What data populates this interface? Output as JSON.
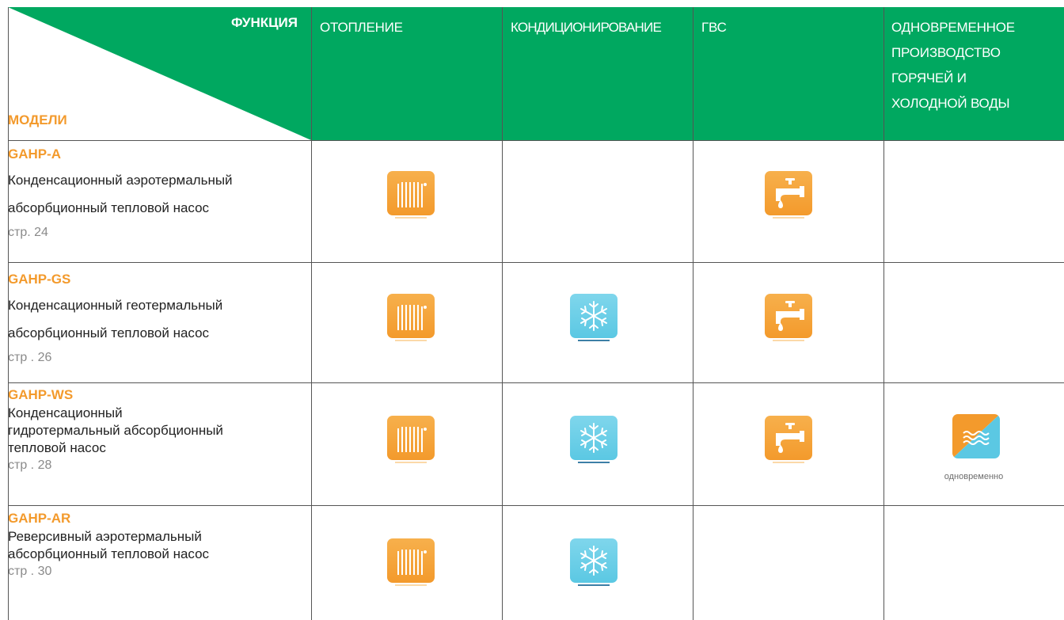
{
  "header": {
    "function_label": "ФУНКЦИЯ",
    "models_label": "МОДЕЛИ",
    "columns": [
      [
        "ОТОПЛЕНИЕ"
      ],
      [
        "КОНДИЦИОНИРОВАНИЕ"
      ],
      [
        "ГВС"
      ],
      [
        "ОДНОВРЕМЕННОЕ",
        "ПРОИЗВОДСТВО",
        "ГОРЯЧЕЙ И",
        "ХОЛОДНОЙ ВОДЫ"
      ]
    ]
  },
  "rows": [
    {
      "name": "GAHP-A",
      "desc": [
        "Конденсационный аэротермальный",
        "абсорбционный тепловой насос"
      ],
      "page": "стр. 24",
      "icons": [
        "radiator-icon",
        null,
        "tap-icon",
        null
      ]
    },
    {
      "name": "GAHP-GS",
      "desc": [
        "Конденсационный геотермальный",
        "абсорбционный тепловой насос"
      ],
      "page": "стр . 26",
      "icons": [
        "radiator-icon",
        "snowflake-icon",
        "tap-icon",
        null
      ]
    },
    {
      "name": "GAHP-WS",
      "desc": [
        "Конденсационный",
        "гидротермальный абсорбционный",
        "тепловой насос"
      ],
      "page": "стр . 28",
      "icons": [
        "radiator-icon",
        "snowflake-icon",
        "tap-icon",
        "simultaneous-icon"
      ]
    },
    {
      "name": "GAHP-AR",
      "desc": [
        "Реверсивный аэротермальный",
        "абсорбционный тепловой насос"
      ],
      "page": "стр . 30",
      "icons": [
        "radiator-icon",
        "snowflake-icon",
        null,
        null
      ]
    }
  ],
  "simultaneous_label": "одновременно",
  "colors": {
    "header_green": "#00a860",
    "accent_orange": "#f39a2c",
    "ice_blue": "#5bc8e3"
  }
}
